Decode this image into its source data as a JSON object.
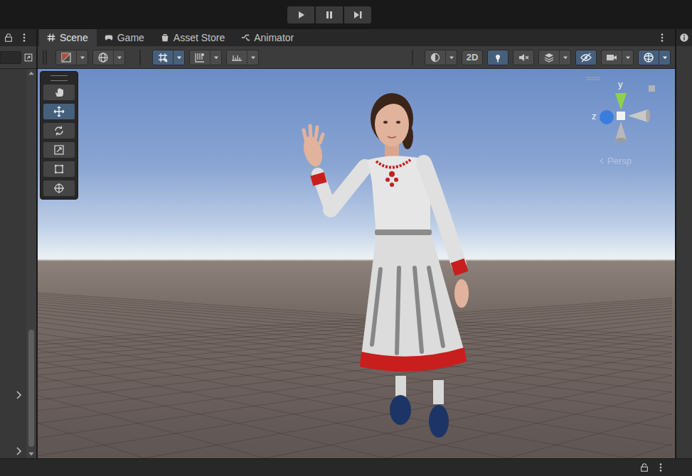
{
  "tabs": [
    {
      "label": "Scene",
      "kind": "scene",
      "selected": true
    },
    {
      "label": "Game",
      "kind": "game",
      "selected": false
    },
    {
      "label": "Asset Store",
      "kind": "store",
      "selected": false
    },
    {
      "label": "Animator",
      "kind": "animator",
      "selected": false
    }
  ],
  "tools": [
    {
      "kind": "hand",
      "selected": false
    },
    {
      "kind": "move",
      "selected": true
    },
    {
      "kind": "rotate",
      "selected": false
    },
    {
      "kind": "scale",
      "selected": false
    },
    {
      "kind": "rect",
      "selected": false
    },
    {
      "kind": "transform",
      "selected": false
    }
  ],
  "toolbar": {
    "left": [
      {
        "kind": "shading",
        "selected": false
      },
      {
        "kind": "pivot",
        "selected": false
      },
      {
        "kind": "grid",
        "selected": true
      },
      {
        "kind": "snap",
        "selected": false
      },
      {
        "kind": "ruler",
        "selected": false
      }
    ],
    "right": [
      {
        "kind": "effects",
        "selected": false
      },
      {
        "kind": "mode-2d",
        "label": "2D",
        "selected": false
      },
      {
        "kind": "lighting",
        "selected": true
      },
      {
        "kind": "audio",
        "selected": false
      },
      {
        "kind": "layers",
        "selected": false
      },
      {
        "kind": "visibility",
        "selected": true
      },
      {
        "kind": "camera",
        "selected": false
      },
      {
        "kind": "gizmos",
        "selected": true
      }
    ]
  },
  "gizmo": {
    "axes": [
      {
        "label": "y",
        "color": "#8fd14a"
      },
      {
        "label": "z",
        "color": "#3b7ddd"
      }
    ],
    "projection": "Persp"
  }
}
